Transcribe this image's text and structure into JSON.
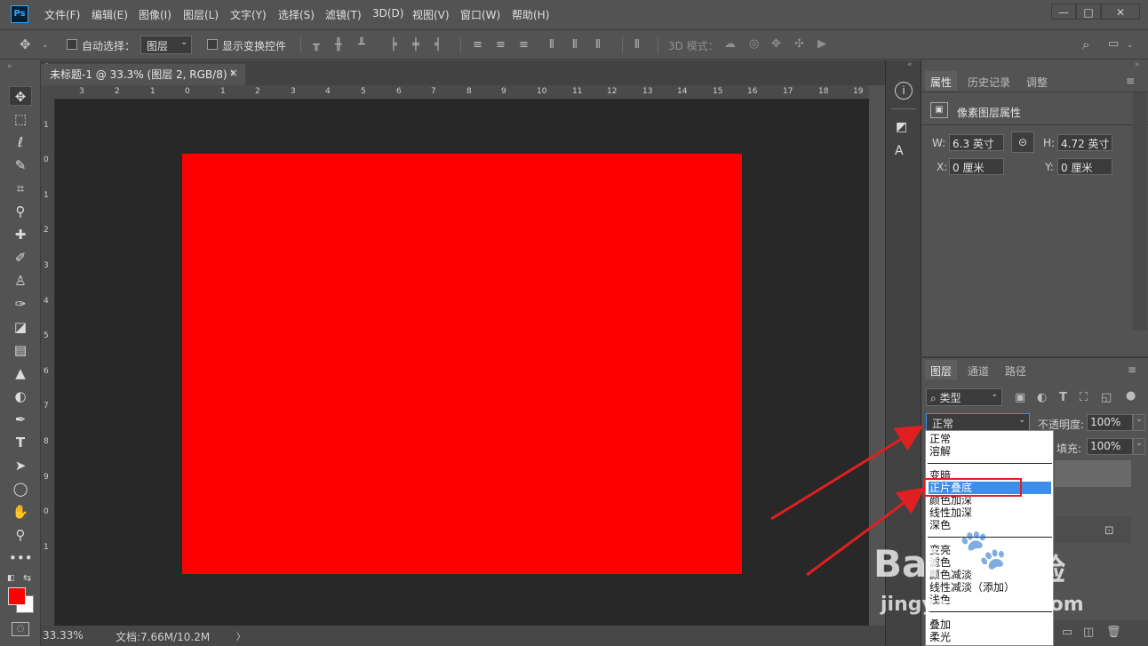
{
  "app": {
    "logo": "Ps"
  },
  "menu": [
    "文件(F)",
    "编辑(E)",
    "图像(I)",
    "图层(L)",
    "文字(Y)",
    "选择(S)",
    "滤镜(T)",
    "3D(D)",
    "视图(V)",
    "窗口(W)",
    "帮助(H)"
  ],
  "window_buttons": {
    "minimize": "—",
    "restore": "□",
    "close": "✕"
  },
  "options": {
    "auto_select_label": "自动选择：",
    "auto_select_value": "图层",
    "show_transform_label": "显示变换控件",
    "mode3d_label": "3D 模式："
  },
  "document": {
    "tab_title": "未标题-1 @ 33.3% (图层 2, RGB/8) *",
    "tab_close": "×",
    "canvas_color": "#ff0000",
    "ruler_h_labels": [
      "3",
      "2",
      "1",
      "0",
      "1",
      "2",
      "3",
      "4",
      "5",
      "6",
      "7",
      "8",
      "9",
      "10",
      "11",
      "12",
      "13",
      "14",
      "15",
      "16",
      "17",
      "18",
      "19"
    ],
    "ruler_v_labels": [
      "1",
      "0",
      "1",
      "2",
      "3",
      "4",
      "5",
      "6",
      "7",
      "8",
      "9",
      "0",
      "1"
    ]
  },
  "status": {
    "zoom": "33.33%",
    "doc_info": "文档:7.66M/10.2M",
    "arrow": "〉"
  },
  "properties": {
    "tabs": [
      "属性",
      "历史记录",
      "调整"
    ],
    "title": "像素图层属性",
    "w_label": "W:",
    "w_value": "6.3 英寸",
    "h_label": "H:",
    "h_value": "4.72 英寸",
    "x_label": "X:",
    "x_value": "0 厘米",
    "y_label": "Y:",
    "y_value": "0 厘米"
  },
  "layers": {
    "tabs": [
      "图层",
      "通道",
      "路径"
    ],
    "filter_kind": "类型",
    "blend_mode": "正常",
    "opacity_label": "不透明度:",
    "opacity_value": "100%",
    "fill_label": "填充:",
    "fill_value": "100%"
  },
  "blend_dropdown": {
    "items": [
      "正常",
      "溶解",
      "变暗",
      "正片叠底",
      "颜色加深",
      "线性加深",
      "深色",
      "变亮",
      "滤色",
      "颜色减淡",
      "线性减淡（添加）",
      "浅色",
      "叠加",
      "柔光"
    ],
    "selected": "正片叠底"
  },
  "watermark": {
    "text1": "Bai",
    "text2": "经验",
    "text3": "jingyan.baidu.com"
  },
  "colors": {
    "foreground": "#ff0000",
    "background": "#ffffff",
    "highlight": "#3d8ee8",
    "annotation": "#e02020"
  }
}
